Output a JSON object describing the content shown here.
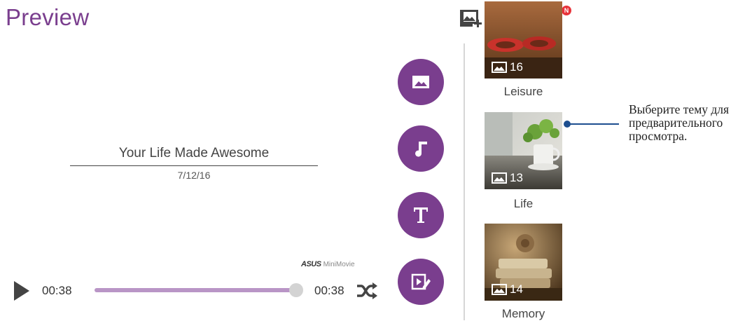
{
  "header": {
    "title": "Preview",
    "notification_badge": "N"
  },
  "preview": {
    "title": "Your Life Made Awesome",
    "date": "7/12/16",
    "brand_logo": "ASUS",
    "brand_text": "MiniMovie"
  },
  "player": {
    "current_time": "00:38",
    "total_time": "00:38",
    "progress": 1.0
  },
  "themes": [
    {
      "label": "Leisure",
      "count": "16"
    },
    {
      "label": "Life",
      "count": "13"
    },
    {
      "label": "Memory",
      "count": "14"
    }
  ],
  "annotation": {
    "text": "Выберите тему для предварительного просмотра."
  },
  "colors": {
    "accent": "#7a3e8e",
    "slider": "#b995c6",
    "callout": "#1d4e8f"
  },
  "icons": {
    "header": [
      "add-photo-icon",
      "save-icon",
      "more-options-icon"
    ],
    "fab": [
      "image-icon",
      "music-note-icon",
      "text-icon",
      "edit-video-icon"
    ],
    "player": [
      "play-icon",
      "shuffle-icon"
    ]
  }
}
